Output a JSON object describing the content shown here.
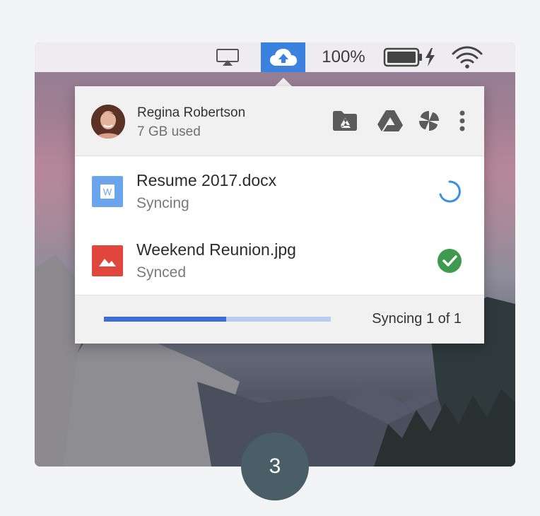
{
  "menubar": {
    "battery_percent": "100%",
    "icons": [
      "airplay-icon",
      "drive-cloud-icon",
      "battery-icon",
      "charging-bolt-icon",
      "wifi-icon"
    ],
    "accent_color": "#3b82e0"
  },
  "account": {
    "name": "Regina Robertson",
    "usage": "7 GB used"
  },
  "header_actions": [
    "open-folder-icon",
    "google-drive-icon",
    "google-photos-icon",
    "more-vert-icon"
  ],
  "files": [
    {
      "name": "Resume 2017.docx",
      "status": "Syncing",
      "type": "word-doc-icon",
      "state": "syncing"
    },
    {
      "name": "Weekend Reunion.jpg",
      "status": "Synced",
      "type": "image-file-icon",
      "state": "synced"
    }
  ],
  "footer": {
    "sync_text": "Syncing 1 of 1",
    "progress": 0.54
  },
  "step": "3",
  "colors": {
    "synced_green": "#3e9a4f",
    "spinner_blue": "#3b8fe0",
    "image_red": "#e0463b",
    "doc_blue": "#6aa4ec"
  }
}
